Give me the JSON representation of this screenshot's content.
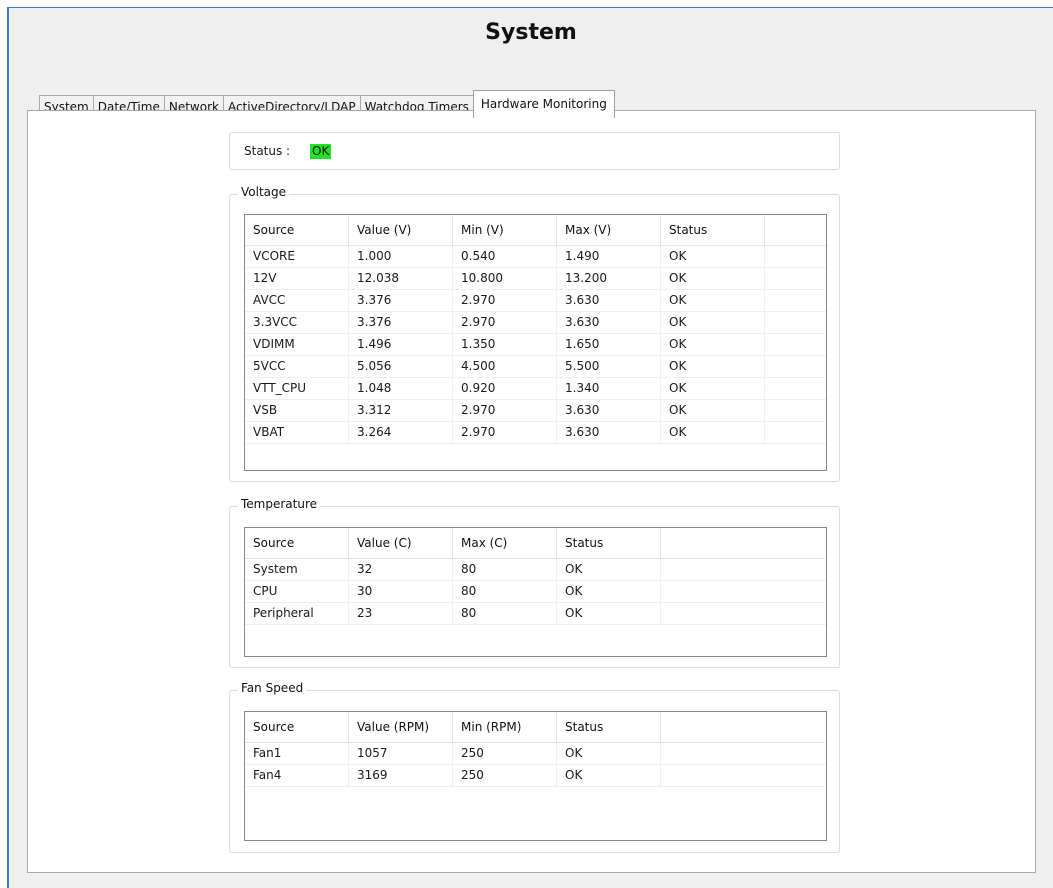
{
  "window": {
    "title": "System"
  },
  "tabs": [
    {
      "label": "System"
    },
    {
      "label": "Date/Time"
    },
    {
      "label": "Network"
    },
    {
      "label": "ActiveDirectory/LDAP"
    },
    {
      "label": "Watchdog Timers"
    },
    {
      "label": "Hardware Monitoring",
      "active": true
    }
  ],
  "status": {
    "label": "Status :",
    "value": "OK",
    "color": "#22e022"
  },
  "voltage": {
    "title": "Voltage",
    "headers": [
      "Source",
      "Value (V)",
      "Min (V)",
      "Max (V)",
      "Status"
    ],
    "rows": [
      [
        "VCORE",
        "1.000",
        "0.540",
        "1.490",
        "OK"
      ],
      [
        "12V",
        "12.038",
        "10.800",
        "13.200",
        "OK"
      ],
      [
        "AVCC",
        "3.376",
        "2.970",
        "3.630",
        "OK"
      ],
      [
        "3.3VCC",
        "3.376",
        "2.970",
        "3.630",
        "OK"
      ],
      [
        "VDIMM",
        "1.496",
        "1.350",
        "1.650",
        "OK"
      ],
      [
        "5VCC",
        "5.056",
        "4.500",
        "5.500",
        "OK"
      ],
      [
        "VTT_CPU",
        "1.048",
        "0.920",
        "1.340",
        "OK"
      ],
      [
        "VSB",
        "3.312",
        "2.970",
        "3.630",
        "OK"
      ],
      [
        "VBAT",
        "3.264",
        "2.970",
        "3.630",
        "OK"
      ]
    ]
  },
  "temperature": {
    "title": "Temperature",
    "headers": [
      "Source",
      "Value (C)",
      "Max (C)",
      "Status"
    ],
    "rows": [
      [
        "System",
        "32",
        "80",
        "OK"
      ],
      [
        "CPU",
        "30",
        "80",
        "OK"
      ],
      [
        "Peripheral",
        "23",
        "80",
        "OK"
      ]
    ]
  },
  "fan": {
    "title": "Fan Speed",
    "headers": [
      "Source",
      "Value (RPM)",
      "Min (RPM)",
      "Status"
    ],
    "rows": [
      [
        "Fan1",
        "1057",
        "250",
        "OK"
      ],
      [
        "Fan4",
        "3169",
        "250",
        "OK"
      ]
    ]
  }
}
